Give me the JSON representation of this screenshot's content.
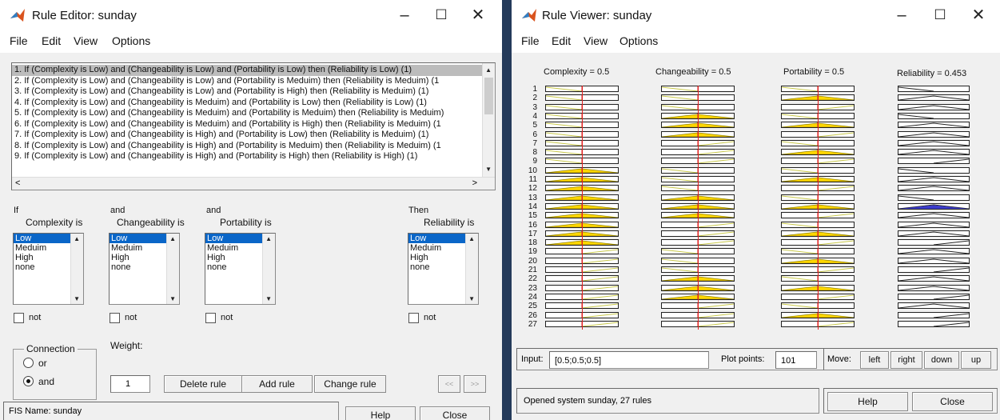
{
  "rule_editor": {
    "title": "Rule Editor: sunday",
    "menu": [
      "File",
      "Edit",
      "View",
      "Options"
    ],
    "rules": [
      "1. If (Complexity is Low) and (Changeability is Low) and (Portability is Low) then (Reliability is Low) (1)",
      "2. If (Complexity is Low) and (Changeability is Low) and (Portability is Meduim) then (Reliability is Meduim) (1",
      "3. If (Complexity is Low) and (Changeability is Low) and (Portability is High) then (Reliability is Meduim) (1)",
      "4. If (Complexity is Low) and (Changeability is Meduim) and (Portability is Low) then (Reliability is Low) (1)",
      "5. If (Complexity is Low) and (Changeability is Meduim) and (Portability is Meduim) then (Reliability is Meduim)",
      "6. If (Complexity is Low) and (Changeability is Meduim) and (Portability is High) then (Reliability is Meduim) (1",
      "7. If (Complexity is Low) and (Changeability is High) and (Portability is Low) then (Reliability is Meduim) (1)",
      "8. If (Complexity is Low) and (Changeability is High) and (Portability is Meduim) then (Reliability is Meduim) (1",
      "9. If (Complexity is Low) and (Changeability is High) and (Portability is High) then (Reliability is High) (1)"
    ],
    "columns": [
      {
        "pre": "If",
        "label": "Complexity is"
      },
      {
        "pre": "and",
        "label": "Changeability is"
      },
      {
        "pre": "and",
        "label": "Portability is"
      },
      {
        "pre": "Then",
        "label": "Reliability is"
      }
    ],
    "options": [
      "Low",
      "Meduim",
      "High",
      "none"
    ],
    "not_label": "not",
    "connection_label": "Connection",
    "or_label": "or",
    "and_label": "and",
    "weight_label": "Weight:",
    "weight_value": "1",
    "delete_rule": "Delete rule",
    "add_rule": "Add rule",
    "change_rule": "Change rule",
    "prev": "<<",
    "next": ">>",
    "fis_name": "FIS Name: sunday",
    "help": "Help",
    "close": "Close"
  },
  "rule_viewer": {
    "title": "Rule Viewer: sunday",
    "menu": [
      "File",
      "Edit",
      "View",
      "Options"
    ],
    "headers": [
      "Complexity = 0.5",
      "Changeability = 0.5",
      "Portability = 0.5",
      "Reliability = 0.453"
    ],
    "row_numbers": [
      "1",
      "2",
      "3",
      "4",
      "5",
      "6",
      "7",
      "8",
      "9",
      "10",
      "11",
      "12",
      "13",
      "14",
      "15",
      "16",
      "17",
      "18",
      "19",
      "20",
      "21",
      "22",
      "23",
      "24",
      "25",
      "26",
      "27"
    ],
    "input_label": "Input:",
    "input_value": "[0.5;0.5;0.5]",
    "plot_points_label": "Plot points:",
    "plot_points_value": "101",
    "move_label": "Move:",
    "left": "left",
    "right": "right",
    "down": "down",
    "up": "up",
    "status": "Opened system sunday, 27 rules",
    "help": "Help",
    "close": "Close",
    "colors": {
      "fill": "#ffd700",
      "output_fill": "#3c3ccc",
      "cursor": "#e02020"
    }
  }
}
